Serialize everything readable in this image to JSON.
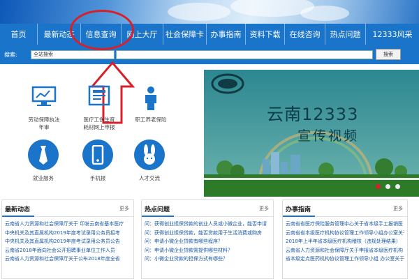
{
  "nav": {
    "items": [
      "首页",
      "最新动态",
      "信息查询",
      "网上大厅",
      "社会保障卡",
      "办事指南",
      "资料下载",
      "在线咨询",
      "热点问题",
      "12333风采"
    ]
  },
  "search": {
    "label": "搜索:",
    "scope": "全站搜索",
    "button": "搜索"
  },
  "services": [
    {
      "label_line1": "劳动保障执法",
      "label_line2": "年审",
      "icon": "monitor-chart-icon"
    },
    {
      "label_line1": "医疗工伤生育",
      "label_line2": "耗材网上申报",
      "icon": "medical-form-icon"
    },
    {
      "label_line1": "职工养老保险",
      "label_line2": "",
      "icon": "person-icon"
    },
    {
      "label_line1": "就业服务",
      "label_line2": "",
      "icon": "tie-icon"
    },
    {
      "label_line1": "手机报",
      "label_line2": "",
      "icon": "phone-icon"
    },
    {
      "label_line1": "人才交流",
      "label_line2": "",
      "icon": "rabbit-icon"
    }
  ],
  "video": {
    "title": "云南12333",
    "subtitle": "宣传视频"
  },
  "panels": [
    {
      "title": "最新动态",
      "more": "更多",
      "items": [
        "云南省人力资源和社会保障厅关于 印发云南省基本医疗",
        "中央机关及其直属机构2019年度考试录用公务员招考",
        "中央机关及其直属机构2019年度考试录用公务员公告",
        "云南省2018年面向社会公开招聘事业单位工作人员",
        "云南省人力资源和社会保障厅关于公布2018年度全省"
      ]
    },
    {
      "title": "热点问题",
      "more": "更多",
      "items": [
        "问：获得创业担保贷款的创业人员或小微企业，能否申请",
        "问：获得创业担保贷款，能否贷款用于生活消费或购房",
        "问：申请小微企业贷款有哪些程序？",
        "问：申请小微企业贷款需提供哪些材料？",
        "问：小微企业贷款的担保方式有哪些？"
      ]
    },
    {
      "title": "办事指南",
      "more": "更多",
      "items": [
        "云南省省医疗保险服务管理中心关于省本级手工报销医",
        "云南省省本级医疗机构协议管理工作领导小组办公室关于",
        "2018年上半年省本级医疗机构稽核（违规处理结果）",
        "云南省人力资源和社会保障厅关于申报省本级医疗机构",
        "省本级定点医药机构协议管理工作领导小组 办公室关于"
      ]
    }
  ]
}
